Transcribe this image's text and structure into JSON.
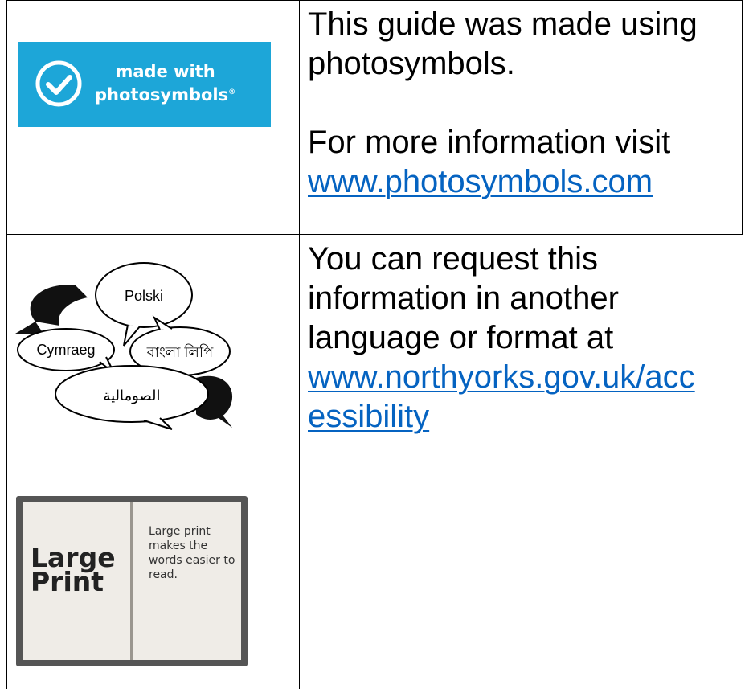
{
  "badge": {
    "line1": "made with",
    "line2": "photosymbols",
    "mark": "®",
    "icon": "check-circle-icon",
    "color": "#1da6d8"
  },
  "row1": {
    "text1": "This guide was made using photosymbols.",
    "text2": "For more information visit",
    "link": "www.photosymbols.com"
  },
  "row2": {
    "text": "You can request this information in another language or format at",
    "link_line1": "www.northyorks.gov.uk/acc",
    "link_line2": "essibility"
  },
  "languages": {
    "polski": "Polski",
    "cymraeg": "Cymraeg",
    "bangla": "বাংলা লিপি",
    "somali_arabic": "الصومالية"
  },
  "large_print": {
    "title_line1": "Large",
    "title_line2": "Print",
    "body": "Large print makes the words easier to read."
  },
  "colors": {
    "link": "#0563c1",
    "badge": "#1da6d8"
  }
}
